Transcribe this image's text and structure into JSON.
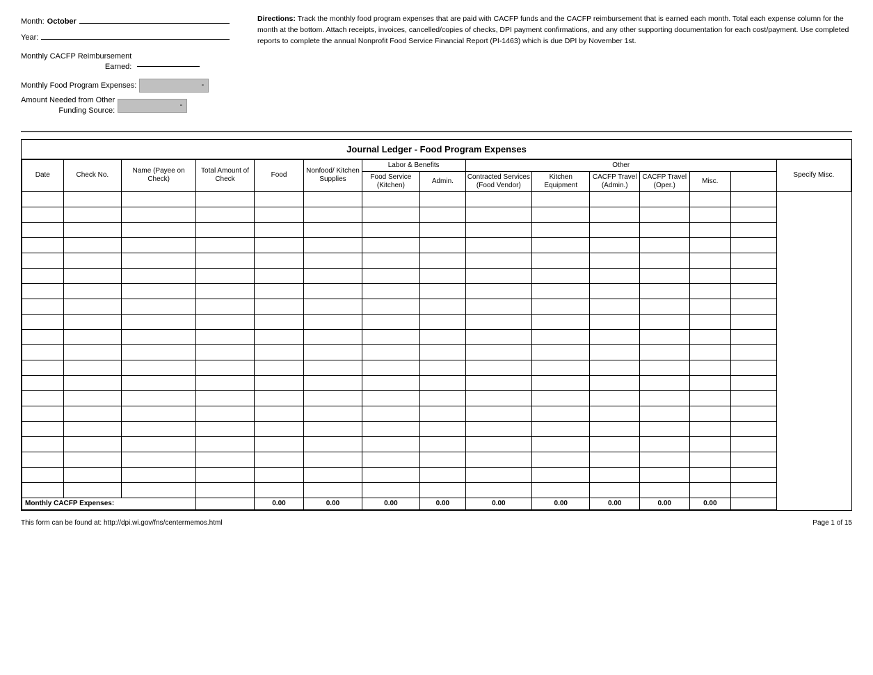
{
  "header": {
    "month_label": "Month:",
    "month_value": "October",
    "year_label": "Year:",
    "reimbursement_label_line1": "Monthly CACFP Reimbursement",
    "reimbursement_label_line2": "Earned:",
    "expenses_label": "Monthly Food Program Expenses:",
    "funding_label_line1": "Amount Needed from Other",
    "funding_label_line2": "Funding Source:",
    "shaded_value1": "-",
    "shaded_value2": "-"
  },
  "directions": {
    "title": "Directions:",
    "text": "Track the monthly food program expenses that are paid with CACFP funds and the CACFP reimbursement that is earned each month. Total each expense column for the month at the bottom. Attach receipts, invoices, cancelled/copies of checks, DPI payment confirmations, and any other supporting documentation for each cost/payment. Use completed reports to complete the annual Nonprofit Food Service Financial Report (PI-1463) which is due DPI by November 1st."
  },
  "ledger": {
    "title": "Journal Ledger - Food Program Expenses",
    "group_labor": "Labor & Benefits",
    "group_other": "Other",
    "columns": {
      "date": "Date",
      "check_no": "Check No.",
      "name": "Name (Payee on Check)",
      "total_amount": "Total Amount of Check",
      "food": "Food",
      "nonfood": "Nonfood/ Kitchen Supplies",
      "food_service": "Food Service (Kitchen)",
      "admin": "Admin.",
      "contracted": "Contracted Services (Food Vendor)",
      "kitchen_equipment": "Kitchen Equipment",
      "cacfp_travel_admin": "CACFP Travel (Admin.)",
      "cacfp_travel_oper": "CACFP Travel (Oper.)",
      "misc": "Misc.",
      "specify_misc": "Specify Misc."
    },
    "footer": {
      "label": "Monthly CACFP Expenses:",
      "food": "0.00",
      "nonfood": "0.00",
      "food_service": "0.00",
      "admin": "0.00",
      "contracted": "0.00",
      "kitchen_equipment": "0.00",
      "cacfp_travel_admin": "0.00",
      "cacfp_travel_oper": "0.00",
      "misc": "0.00"
    },
    "empty_rows": 20
  },
  "page_footer": {
    "url_text": "This form can be found at: http://dpi.wi.gov/fns/centermemos.html",
    "page_text": "Page 1 of 15"
  }
}
